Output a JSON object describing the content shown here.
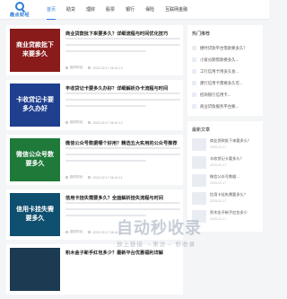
{
  "logo": {
    "text": "趣点财经"
  },
  "nav": [
    "首页",
    "助贷",
    "理财",
    "股票",
    "银行",
    "保险",
    "互联网金融"
  ],
  "articles": [
    {
      "thumb_text": "商业贷款批下来要多久",
      "thumb_color": "#8a1b1b",
      "title": "商业贷款批下来要多久？详细流程与时间优化技巧",
      "author": "趣财财经",
      "date": "2025-02-17 06:41:12"
    },
    {
      "thumb_text": "卡收贷记卡要多久办好",
      "thumb_color": "#1f3f8f",
      "title": "丰收贷记卡要多久办好？详细解析办卡流程与时间",
      "author": "趣财财经",
      "date": "2025-02-17 06:41:12"
    },
    {
      "thumb_text": "微信公众号数要多久",
      "thumb_color": "#1f7a3a",
      "title": "微信公众号数据哪个好用？精选五大实用的公众号推荐",
      "author": "趣财财经",
      "date": "2025-02-17 06:41:11"
    },
    {
      "thumb_text": "信用卡挂失需要多久",
      "thumb_color": "#0f4f6f",
      "title": "信用卡挂失需要多久？全面解析挂失流程与时间",
      "author": "趣财财经",
      "date": "2025-02-17 06:41:11"
    },
    {
      "thumb_text": "",
      "thumb_color": "#1c3b52",
      "title": "积木金子新手红包多少？最新平台优惠福利详解",
      "author": "",
      "date": ""
    }
  ],
  "sidebar": {
    "hot_title": "热门推荐",
    "hot_items": [
      "捷时贷款平台借款要多久？",
      "小爱分期借款要多久...",
      "工行信用卡用多久会...",
      "建行信用卡需要多久可...",
      "招商银行信用卡...",
      "商业贷款服务平台要..."
    ],
    "new_title": "最新文章",
    "new_items": [
      {
        "title": "商业贷款批下来要多久？",
        "sub": "2025-02-17"
      },
      {
        "title": "丰收贷记卡要多久？",
        "sub": "2025-02-17"
      },
      {
        "title": "微信公众号数据...",
        "sub": "2025-02-17"
      },
      {
        "title": "信用卡挂失需要多久？",
        "sub": "2025-02-17"
      },
      {
        "title": "积木金子新手红包多少",
        "sub": "2025-02-17"
      }
    ]
  },
  "watermark": {
    "main": "自动秒收录",
    "sub": "放上链接 →来访→ 秒收录"
  }
}
